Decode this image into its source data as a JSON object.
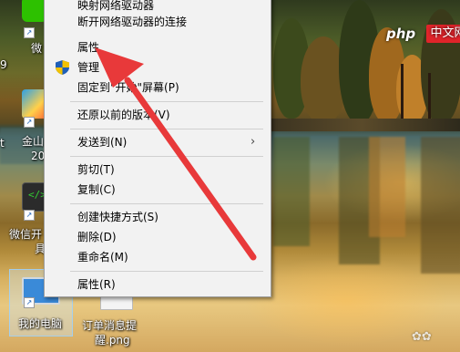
{
  "context_menu": {
    "items": [
      {
        "label": "映射网络驱动器",
        "icon": ""
      },
      {
        "label": "断开网络驱动器的连接",
        "icon": ""
      },
      {
        "label": "属性",
        "icon": ""
      },
      {
        "label": "管理",
        "icon": "uac-shield-icon"
      },
      {
        "label": "固定到\"开始\"屏幕(P)",
        "icon": ""
      },
      {
        "label": "还原以前的版本(V)",
        "icon": ""
      },
      {
        "label": "发送到(N)",
        "icon": "",
        "submenu": true
      },
      {
        "label": "剪切(T)",
        "icon": ""
      },
      {
        "label": "复制(C)",
        "icon": ""
      },
      {
        "label": "创建快捷方式(S)",
        "icon": ""
      },
      {
        "label": "删除(D)",
        "icon": ""
      },
      {
        "label": "重命名(M)",
        "icon": ""
      },
      {
        "label": "属性(R)",
        "icon": ""
      }
    ],
    "submenu_glyph": "›"
  },
  "desktop": {
    "icons": [
      {
        "label": "微",
        "app": "wechat-icon"
      },
      {
        "label": "金山",
        "label2": "20",
        "app": "wps-icon"
      },
      {
        "label": "微信开",
        "label2": "具",
        "app": "wechat-devtools-icon"
      },
      {
        "label": "我的电脑",
        "app": "computer-icon"
      },
      {
        "label": "订单消息提",
        "label2": "醒.png",
        "app": "image-file-icon"
      }
    ],
    "edge_fragments": [
      "9",
      "t"
    ]
  },
  "watermark": {
    "php": "php",
    "cn": "中文网"
  },
  "annotation": {
    "color": "#e8393a"
  }
}
